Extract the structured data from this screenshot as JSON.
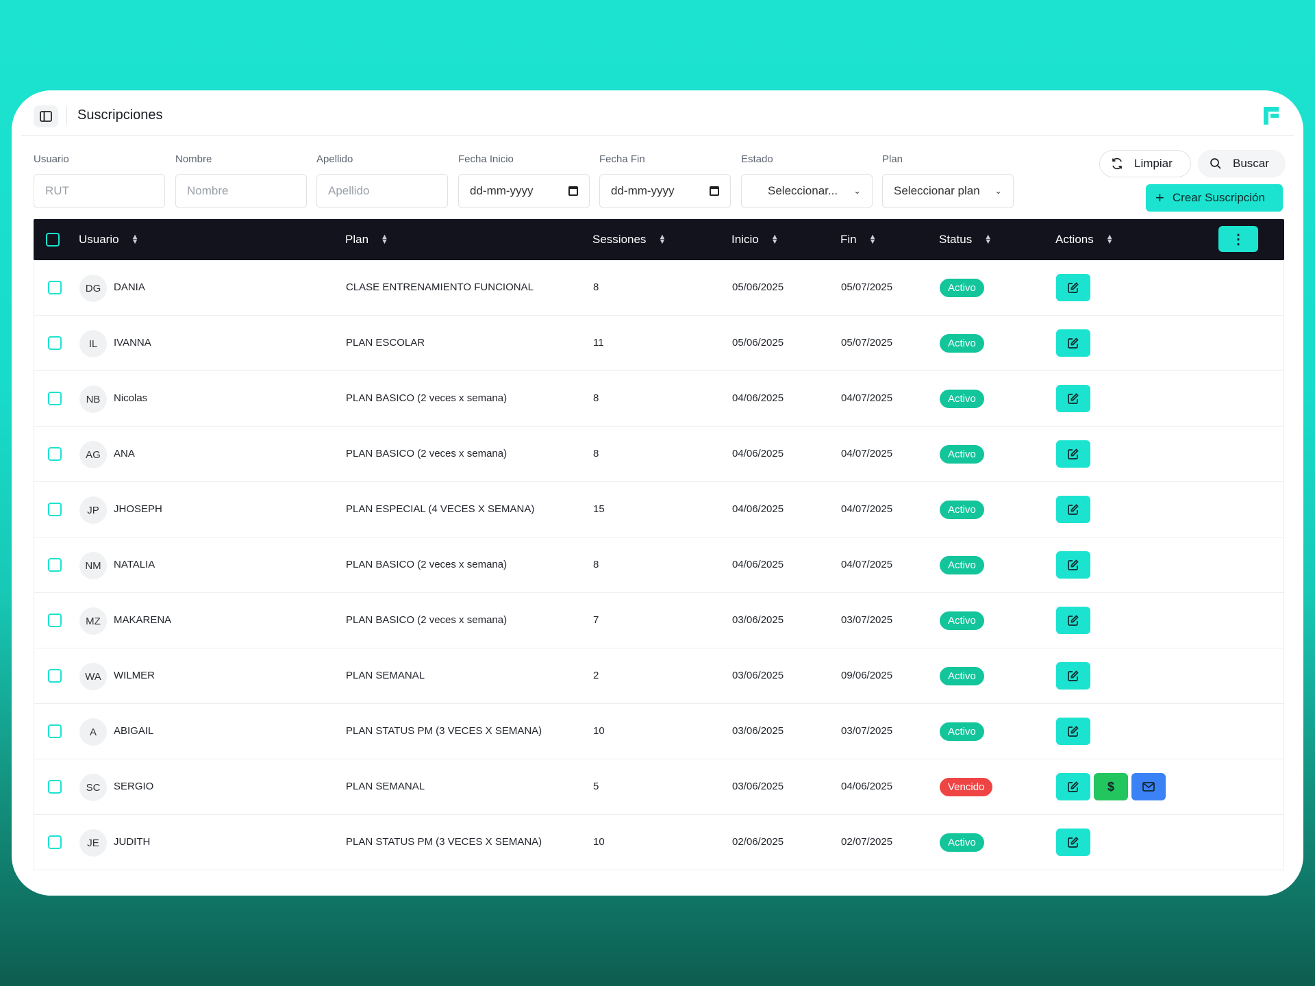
{
  "header": {
    "title": "Suscripciones"
  },
  "filters": {
    "usuario": {
      "label": "Usuario",
      "placeholder": "RUT"
    },
    "nombre": {
      "label": "Nombre",
      "placeholder": "Nombre"
    },
    "apellido": {
      "label": "Apellido",
      "placeholder": "Apellido"
    },
    "fecha_inicio": {
      "label": "Fecha Inicio",
      "value": "dd-mm-yyyy"
    },
    "fecha_fin": {
      "label": "Fecha Fin",
      "value": "dd-mm-yyyy"
    },
    "estado": {
      "label": "Estado",
      "value": "Seleccionar..."
    },
    "plan": {
      "label": "Plan",
      "value": "Seleccionar plan"
    },
    "limpiar_label": "Limpiar",
    "buscar_label": "Buscar",
    "crear_label": "Crear Suscripción"
  },
  "table": {
    "columns": [
      "Usuario",
      "Plan",
      "Sessiones",
      "Inicio",
      "Fin",
      "Status",
      "Actions"
    ],
    "rows": [
      {
        "initials": "DG",
        "name": "DANIA",
        "plan": "CLASE ENTRENAMIENTO FUNCIONAL",
        "sessions": "8",
        "start": "05/06/2025",
        "end": "05/07/2025",
        "status": "Activo",
        "extra_actions": false
      },
      {
        "initials": "IL",
        "name": "IVANNA",
        "plan": "PLAN ESCOLAR",
        "sessions": "11",
        "start": "05/06/2025",
        "end": "05/07/2025",
        "status": "Activo",
        "extra_actions": false
      },
      {
        "initials": "NB",
        "name": "Nicolas",
        "plan": "PLAN BASICO (2 veces x semana)",
        "sessions": "8",
        "start": "04/06/2025",
        "end": "04/07/2025",
        "status": "Activo",
        "extra_actions": false
      },
      {
        "initials": "AG",
        "name": "ANA",
        "plan": "PLAN BASICO (2 veces x semana)",
        "sessions": "8",
        "start": "04/06/2025",
        "end": "04/07/2025",
        "status": "Activo",
        "extra_actions": false
      },
      {
        "initials": "JP",
        "name": "JHOSEPH",
        "plan": "PLAN ESPECIAL (4 VECES X SEMANA)",
        "sessions": "15",
        "start": "04/06/2025",
        "end": "04/07/2025",
        "status": "Activo",
        "extra_actions": false
      },
      {
        "initials": "NM",
        "name": "NATALIA",
        "plan": "PLAN BASICO (2 veces x semana)",
        "sessions": "8",
        "start": "04/06/2025",
        "end": "04/07/2025",
        "status": "Activo",
        "extra_actions": false
      },
      {
        "initials": "MZ",
        "name": "MAKARENA",
        "plan": "PLAN BASICO (2 veces x semana)",
        "sessions": "7",
        "start": "03/06/2025",
        "end": "03/07/2025",
        "status": "Activo",
        "extra_actions": false
      },
      {
        "initials": "WA",
        "name": "WILMER",
        "plan": "PLAN SEMANAL",
        "sessions": "2",
        "start": "03/06/2025",
        "end": "09/06/2025",
        "status": "Activo",
        "extra_actions": false
      },
      {
        "initials": "A",
        "name": "ABIGAIL",
        "plan": "PLAN STATUS PM (3 VECES X SEMANA)",
        "sessions": "10",
        "start": "03/06/2025",
        "end": "03/07/2025",
        "status": "Activo",
        "extra_actions": false
      },
      {
        "initials": "SC",
        "name": "SERGIO",
        "plan": "PLAN SEMANAL",
        "sessions": "5",
        "start": "03/06/2025",
        "end": "04/06/2025",
        "status": "Vencido",
        "extra_actions": true
      },
      {
        "initials": "JE",
        "name": "JUDITH",
        "plan": "PLAN STATUS PM (3 VECES X SEMANA)",
        "sessions": "10",
        "start": "02/06/2025",
        "end": "02/07/2025",
        "status": "Activo",
        "extra_actions": false
      }
    ]
  },
  "colors": {
    "accent": "#1ce3d0",
    "header_bg": "#12131d",
    "active": "#12c59b",
    "expired": "#ef4444",
    "pay": "#22c55e",
    "mail": "#3b82f6"
  },
  "icons": {
    "edit": "edit-icon",
    "pay": "dollar-icon",
    "mail": "mail-icon",
    "refresh": "refresh-icon",
    "search": "search-icon",
    "plus": "plus-icon",
    "kebab": "more-vertical-icon",
    "sidebar": "sidebar-toggle-icon",
    "logo": "brand-logo-icon"
  }
}
